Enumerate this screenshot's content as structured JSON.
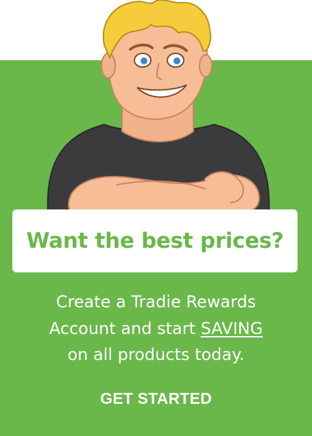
{
  "colors": {
    "brand_green": "#6ab84a",
    "card_background": "#ffffff",
    "text_on_green": "#ffffff"
  },
  "mascot": {
    "icon": "tradie-mascot-illustration"
  },
  "promo": {
    "headline": "Want the best prices?",
    "body_line1": "Create a Tradie Rewards",
    "body_line2_prefix": "Account and start ",
    "body_line2_emphasis": "SAVING",
    "body_line3": "on all products today."
  },
  "cta": {
    "label": "GET STARTED"
  }
}
